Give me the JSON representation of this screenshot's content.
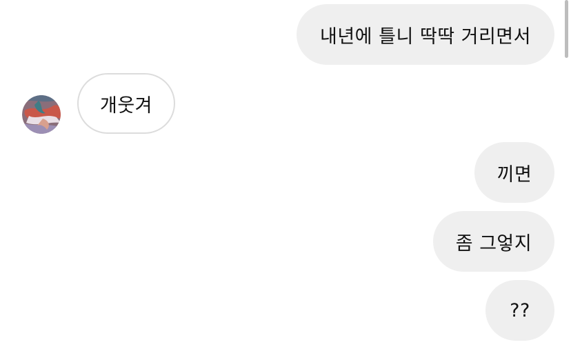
{
  "messages": [
    {
      "direction": "sent",
      "text": "내년에 틀니 딱딱 거리면서"
    },
    {
      "direction": "received",
      "text": "개웃겨"
    },
    {
      "direction": "sent",
      "text": "끼면"
    },
    {
      "direction": "sent",
      "text": "좀 그엏지"
    },
    {
      "direction": "sent",
      "text": "??"
    }
  ],
  "colors": {
    "sent_bubble": "#efefef",
    "received_border": "#dcdcdc",
    "text": "#111111"
  },
  "icons": {
    "avatar": "contact-avatar"
  }
}
